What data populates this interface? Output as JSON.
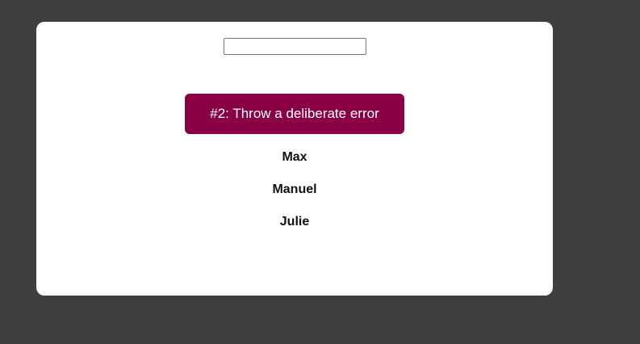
{
  "search": {
    "value": "",
    "placeholder": ""
  },
  "error_button": {
    "label": "#2: Throw a deliberate error"
  },
  "users": [
    "Max",
    "Manuel",
    "Julie"
  ],
  "colors": {
    "background": "#3f3f3f",
    "card": "#ffffff",
    "accent": "#8a0045"
  }
}
